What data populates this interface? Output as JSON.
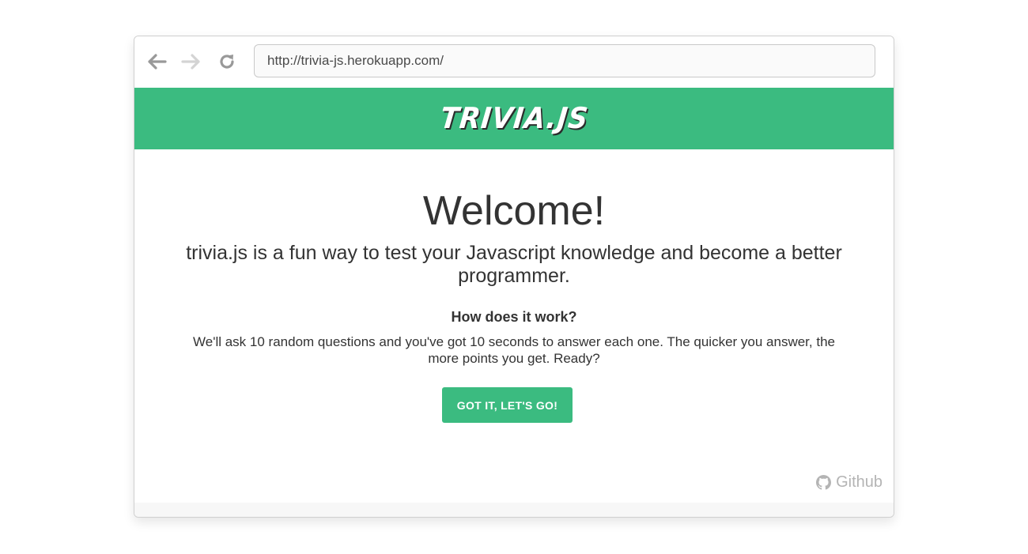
{
  "browser": {
    "url": "http://trivia-js.herokuapp.com/",
    "icons": {
      "back": "arrow-left-icon",
      "forward": "arrow-right-icon",
      "reload": "reload-icon"
    }
  },
  "header": {
    "logo_text": "TRIVIA.JS"
  },
  "main": {
    "title": "Welcome!",
    "intro": "trivia.js is a fun way to test your Javascript knowledge and become a better programmer.",
    "how_title": "How does it work?",
    "how_text": "We'll ask 10 random questions and you've got 10 seconds to answer each one. The quicker you answer, the more points you get. Ready?",
    "start_button_label": "GOT IT, LET'S GO!"
  },
  "footer": {
    "github_label": "Github"
  },
  "colors": {
    "brand_green": "#3bbb80",
    "text": "#333333",
    "muted": "#b4b4b4"
  }
}
